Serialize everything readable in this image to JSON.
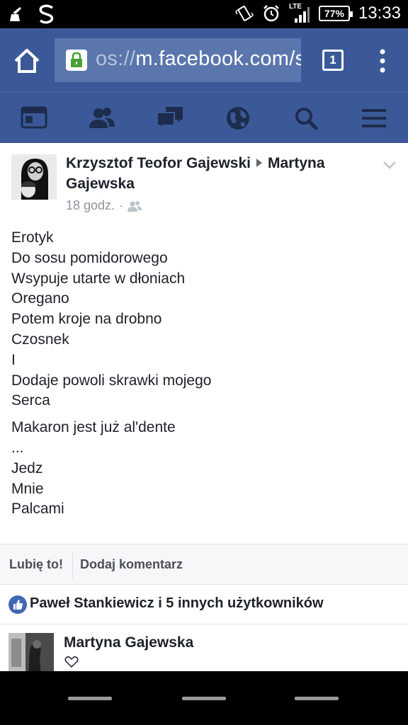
{
  "status_bar": {
    "network": "LTE",
    "battery": "77%",
    "time": "13:33"
  },
  "browser": {
    "url_prefix": "os://",
    "url_domain": "m.facebook.com/s",
    "tab_count": "1"
  },
  "fb_nav": {
    "icons": [
      "news-feed-icon",
      "friends-icon",
      "messages-icon",
      "globe-icon",
      "search-icon",
      "hamburger-menu-icon"
    ]
  },
  "post": {
    "author": "Krzysztof Teofor Gajewski",
    "recipient": "Martyna Gajewska",
    "time": "18 godz.",
    "audience_icon": "friends-icon",
    "body_lines_1": [
      "Erotyk",
      "Do sosu pomidorowego",
      "Wsypuje utarte w dłoniach",
      "Oregano",
      "Potem kroje na drobno",
      "Czosnek",
      "I",
      "Dodaje powoli skrawki mojego",
      "Serca"
    ],
    "body_lines_2": [
      "Makaron jest już al'dente",
      "...",
      "Jedz",
      "Mnie",
      "Palcami"
    ]
  },
  "actions": {
    "like": "Lubię to!",
    "comment": "Dodaj komentarz"
  },
  "likes": {
    "text": "Paweł Stankiewicz i 5 innych użytkowników"
  },
  "comment": {
    "author": "Martyna Gajewska"
  },
  "colors": {
    "fb_blue": "#3b5998",
    "url_box": "#5a76ad",
    "lock_green": "#47a036",
    "like_blue": "#4267b2"
  }
}
